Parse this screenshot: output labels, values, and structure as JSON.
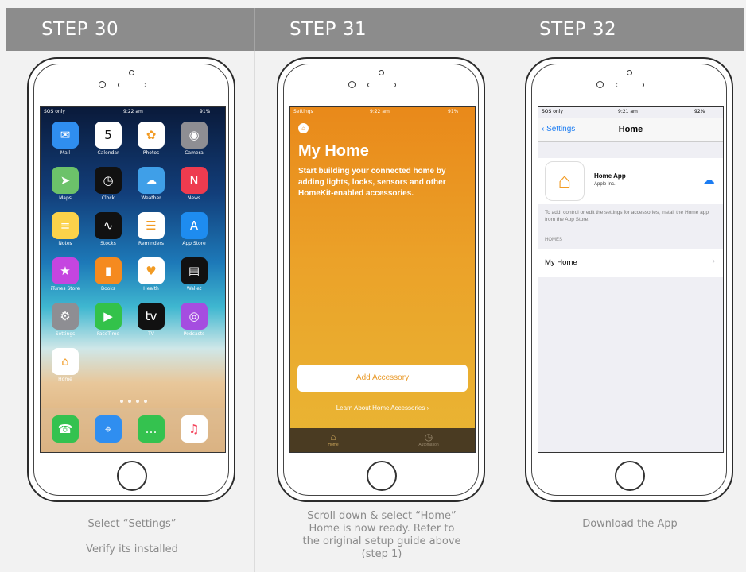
{
  "steps": [
    {
      "label": "STEP 30",
      "captions": [
        "Select “Settings”",
        "Verify its installed"
      ]
    },
    {
      "label": "STEP 31",
      "captions": [
        "Scroll down & select “Home”",
        "Home is now ready. Refer to the original setup guide above (step 1)"
      ]
    },
    {
      "label": "STEP 32",
      "captions": [
        "Download the App"
      ]
    }
  ],
  "screen30": {
    "status": {
      "carrier": "SOS only",
      "time": "9:22 am",
      "battery": "91%"
    },
    "apps": [
      {
        "label": "Mail",
        "icon": "mail-icon",
        "glyph": "✉",
        "color": "#2f8ef0"
      },
      {
        "label": "Calendar",
        "icon": "calendar-icon",
        "glyph": "5",
        "color": "#ffffff"
      },
      {
        "label": "Photos",
        "icon": "photos-icon",
        "glyph": "✿",
        "color": "#ffffff"
      },
      {
        "label": "Camera",
        "icon": "camera-icon",
        "glyph": "◉",
        "color": "#8e8e93"
      },
      {
        "label": "Maps",
        "icon": "maps-icon",
        "glyph": "➤",
        "color": "#6cc26a"
      },
      {
        "label": "Clock",
        "icon": "clock-icon",
        "glyph": "◷",
        "color": "#111111"
      },
      {
        "label": "Weather",
        "icon": "weather-icon",
        "glyph": "☁",
        "color": "#3f9fe8"
      },
      {
        "label": "News",
        "icon": "news-icon",
        "glyph": "N",
        "color": "#ee3b4f"
      },
      {
        "label": "Notes",
        "icon": "notes-icon",
        "glyph": "≡",
        "color": "#fbd24a"
      },
      {
        "label": "Stocks",
        "icon": "stocks-icon",
        "glyph": "∿",
        "color": "#111111"
      },
      {
        "label": "Reminders",
        "icon": "reminders-icon",
        "glyph": "☰",
        "color": "#ffffff"
      },
      {
        "label": "App Store",
        "icon": "app-store-icon",
        "glyph": "A",
        "color": "#1e8cf0"
      },
      {
        "label": "iTunes Store",
        "icon": "itunes-store-icon",
        "glyph": "★",
        "color": "#c545e0"
      },
      {
        "label": "Books",
        "icon": "books-icon",
        "glyph": "▮",
        "color": "#f58a1f"
      },
      {
        "label": "Health",
        "icon": "health-icon",
        "glyph": "♥",
        "color": "#ffffff"
      },
      {
        "label": "Wallet",
        "icon": "wallet-icon",
        "glyph": "▤",
        "color": "#111111"
      },
      {
        "label": "Settings",
        "icon": "settings-icon",
        "glyph": "⚙",
        "color": "#8e8e93"
      },
      {
        "label": "FaceTime",
        "icon": "facetime-icon",
        "glyph": "▶",
        "color": "#33c24a"
      },
      {
        "label": "TV",
        "icon": "tv-icon",
        "glyph": "tv",
        "color": "#111111"
      },
      {
        "label": "Podcasts",
        "icon": "podcasts-icon",
        "glyph": "◎",
        "color": "#a54de0"
      },
      {
        "label": "Home",
        "icon": "home-icon",
        "glyph": "⌂",
        "color": "#ffffff"
      }
    ],
    "dock": [
      {
        "name": "phone",
        "icon": "phone-icon",
        "glyph": "☎",
        "color": "#34c24f"
      },
      {
        "name": "safari",
        "icon": "safari-icon",
        "glyph": "⌖",
        "color": "#2f8ef0"
      },
      {
        "name": "messages",
        "icon": "messages-icon",
        "glyph": "…",
        "color": "#34c24f"
      },
      {
        "name": "music",
        "icon": "music-icon",
        "glyph": "♫",
        "color": "#ffffff"
      }
    ]
  },
  "screen31": {
    "status": {
      "carrier": "Settings",
      "time": "9:22 am",
      "battery": "91%"
    },
    "title": "My Home",
    "description": "Start building your connected home by adding lights, locks, sensors and other HomeKit-enabled accessories.",
    "add_button": "Add Accessory",
    "learn_link": "Learn About Home Accessories ›",
    "tabs": [
      {
        "label": "Home",
        "glyph": "⌂"
      },
      {
        "label": "Automation",
        "glyph": "◷"
      }
    ]
  },
  "screen32": {
    "status": {
      "carrier": "SOS only",
      "time": "9:21 am",
      "battery": "92%"
    },
    "back_label": "Settings",
    "nav_title": "Home",
    "app_name": "Home App",
    "app_developer": "Apple Inc.",
    "note": "To add, control or edit the settings for accessories, install the Home app from the App Store.",
    "section_header": "HOMES",
    "row_label": "My Home"
  },
  "colors": {
    "header": "#8c8c8c",
    "home_orange": "#e9891a",
    "ios_blue": "#1b7cf2"
  }
}
